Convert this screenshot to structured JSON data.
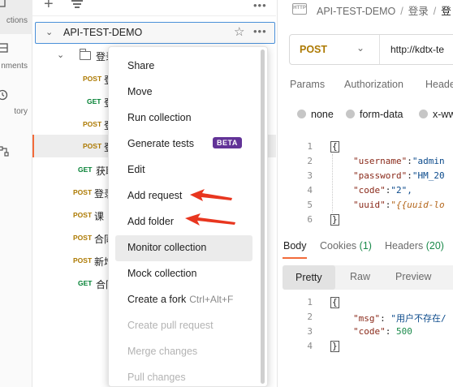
{
  "rail": {
    "items": [
      {
        "label": "ctions",
        "icon": "collections-icon",
        "active": true
      },
      {
        "label": "nments",
        "icon": "environments-icon"
      },
      {
        "label": "tory",
        "icon": "history-icon"
      },
      {
        "label": "",
        "icon": "flows-icon"
      }
    ]
  },
  "sidebar": {
    "new_icon": "+",
    "more_icon": "•••",
    "collection": {
      "name": "API-TEST-DEMO",
      "expanded": true
    },
    "folder": {
      "label": "登录"
    },
    "rows": [
      {
        "method": "POST",
        "label": "登"
      },
      {
        "method": "GET",
        "label": "登"
      },
      {
        "method": "POST",
        "label": "登"
      },
      {
        "method": "POST",
        "label": "登"
      },
      {
        "method": "GET",
        "label": "获取"
      },
      {
        "method": "POST",
        "label": "登录"
      },
      {
        "method": "POST",
        "label": "课"
      },
      {
        "method": "POST",
        "label": "合同"
      },
      {
        "method": "POST",
        "label": "新增"
      },
      {
        "method": "GET",
        "label": "合同"
      }
    ]
  },
  "context_menu": {
    "items": [
      {
        "label": "Share"
      },
      {
        "label": "Move"
      },
      {
        "label": "Run collection"
      },
      {
        "label": "Generate tests",
        "badge": "BETA"
      },
      {
        "label": "Edit"
      },
      {
        "label": "Add request"
      },
      {
        "label": "Add folder"
      },
      {
        "label": "Monitor collection",
        "hover": true
      },
      {
        "label": "Mock collection"
      },
      {
        "label": "Create a fork",
        "shortcut": "Ctrl+Alt+F"
      },
      {
        "label": "Create pull request",
        "disabled": true
      },
      {
        "label": "Merge changes",
        "disabled": true
      },
      {
        "label": "Pull changes",
        "disabled": true
      }
    ],
    "annotation_color": "#e8361f"
  },
  "main": {
    "http_badge": "HTTP",
    "breadcrumb": [
      "API-TEST-DEMO",
      "登录",
      "登"
    ],
    "request": {
      "method": "POST",
      "url": "http://kdtx-te"
    },
    "tabs": [
      "Params",
      "Authorization",
      "Heade"
    ],
    "body_types": [
      "none",
      "form-data",
      "x-ww"
    ],
    "request_body": {
      "line_numbers": [
        "1",
        "2",
        "3",
        "4",
        "5",
        "6"
      ],
      "open_brace": "{",
      "close_brace": "}",
      "fields": [
        {
          "key": "\"username\"",
          "value": "\"admin"
        },
        {
          "key": "\"password\"",
          "value": "\"HM_20"
        },
        {
          "key": "\"code\"",
          "value": "\"2\","
        },
        {
          "key": "\"uuid\"",
          "value": "\"{{uuid-lo"
        }
      ]
    },
    "response_tabs": {
      "body": "Body",
      "cookies": "Cookies",
      "cookies_count": "(1)",
      "headers": "Headers",
      "headers_count": "(20)"
    },
    "formats": [
      "Pretty",
      "Raw",
      "Preview"
    ],
    "response_body": {
      "line_numbers": [
        "1",
        "2",
        "3",
        "4"
      ],
      "open_brace": "{",
      "close_brace": "}",
      "msg_key": "\"msg\"",
      "msg_value": "\"用户不存在/",
      "code_key": "\"code\"",
      "code_value": "500"
    }
  }
}
